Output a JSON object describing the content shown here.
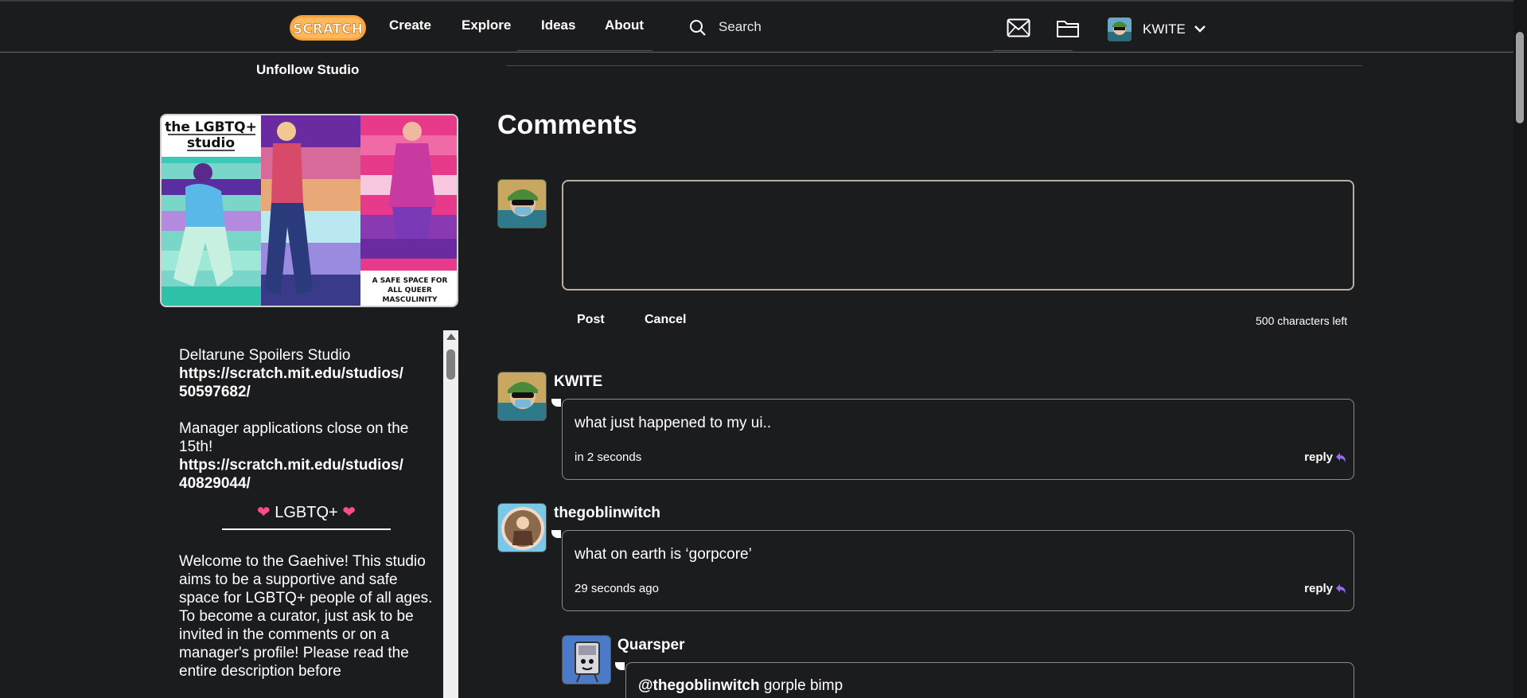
{
  "nav": {
    "logo_text": "SCRATCH",
    "create": "Create",
    "explore": "Explore",
    "ideas": "Ideas",
    "about": "About",
    "search_placeholder": "Search",
    "username": "KWITE",
    "icons": [
      "search-icon",
      "messages-icon",
      "my-stuff-folder-icon",
      "chevron-down-icon"
    ]
  },
  "studio": {
    "unfollow_label": "Unfollow Studio",
    "thumbnail": {
      "title_line1": "the LGBTQ+",
      "title_line2": "studio",
      "caption_line1": "A SAFE SPACE FOR",
      "caption_line2": "ALL QUEER",
      "caption_line3": "MASCULINITY"
    },
    "description": {
      "line1": "Deltarune Spoilers Studio",
      "link1a": "https://scratch.mit.edu/studios/",
      "link1b": "50597682/",
      "line2": "Manager applications close on the 15th!",
      "link2a": "https://scratch.mit.edu/studios/",
      "link2b": "40829044/",
      "heading": "LGBTQ+",
      "welcome": "Welcome to the Gaehive! This studio aims to be a supportive and safe space for LGBTQ+ people of all ages. To become a curator, just ask to be invited in the comments or on a manager's profile! Please read the entire description before"
    }
  },
  "comments": {
    "title": "Comments",
    "post_label": "Post",
    "cancel_label": "Cancel",
    "chars_left": "500 characters left",
    "reply_label": "reply",
    "items": [
      {
        "author": "KWITE",
        "text": "what just happened to my ui..",
        "time": "in 2 seconds"
      },
      {
        "author": "thegoblinwitch",
        "text": "what on earth is ‘gorpcore’",
        "time": "29 seconds ago"
      },
      {
        "author": "Quarsper",
        "mention": "@thegoblinwitch",
        "text": "gorple bimp"
      }
    ]
  },
  "colors": {
    "background": "#1b1c1d",
    "heart": "#ff4a8a",
    "reply_arrow": "#9966ff",
    "logo_orange": "#f9a23a"
  }
}
